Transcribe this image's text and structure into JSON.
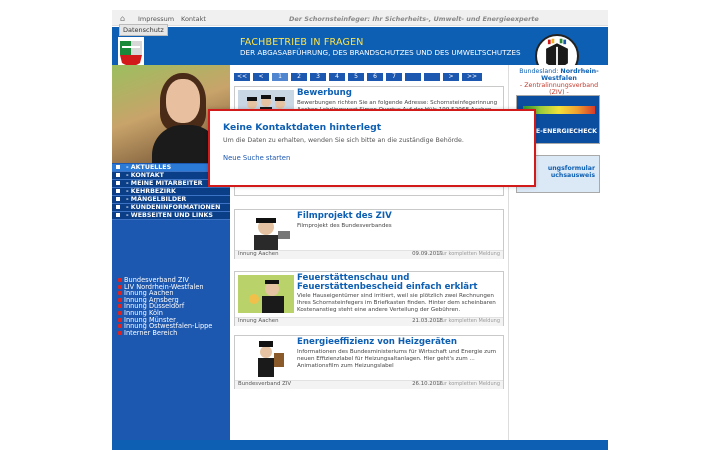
{
  "topbar": {
    "impressum": "Impressum",
    "kontakt": "Kontakt",
    "slogan": "Der Schornsteinfeger: Ihr Sicherheits-, Umwelt- und Energieexperte",
    "datenschutz": "Datenschutz"
  },
  "header": {
    "line1": "FACHBETRIEB IN FRAGEN",
    "line2": "DER ABGASABFÜHRUNG, DES BRANDSCHUTZES UND DES UMWELTSCHUTZES"
  },
  "nav": [
    {
      "label": "- AKTUELLES",
      "active": true
    },
    {
      "label": "- KONTAKT"
    },
    {
      "label": "- MEINE MITARBEITER"
    },
    {
      "label": "- KEHRBEZIRK"
    },
    {
      "label": "- MÄNGELBILDER"
    },
    {
      "label": "- KUNDENINFORMATIONEN"
    },
    {
      "label": "- WEBSEITEN UND LINKS"
    }
  ],
  "links": [
    "Bundesverband ZIV",
    "LIV Nordrhein-Westfalen",
    "Innung Aachen",
    "Innung Arnsberg",
    "Innung Düsseldorf",
    "Innung Köln",
    "Innung Münster",
    "Innung Ostwestfalen-Lippe",
    "Interner Bereich"
  ],
  "pager": [
    "<<",
    "<",
    "1",
    "2",
    "3",
    "4",
    "5",
    "6",
    "7",
    "",
    "",
    ">",
    ">>"
  ],
  "cards": [
    {
      "title": "Bewerbung",
      "text": "Bewerbungen richten Sie an folgende Adresse: Schornsteinfegerinnung Aachen Lehrlingswart  Simon Overtus Auf der Hüls 199 52068 Aachen",
      "source": "",
      "date": "",
      "more": ""
    },
    {
      "title": "Filmprojekt des ZIV",
      "text": "Filmprojekt des Bundesverbandes",
      "source": "Innung Aachen",
      "date": "09.09.2019",
      "more": "Zur kompletten Meldung"
    },
    {
      "title": "Feuerstättenschau und Feuerstättenbescheid einfach erklärt",
      "text": "Viele Hauseigentümer sind irritiert, weil sie plötzlich zwei Rechnungen Ihres Schornsteinfegers im Briefkasten finden. Hinter dem scheinbaren Kostenanstieg steht eine andere Verteilung der Gebühren.",
      "source": "Innung Aachen",
      "date": "21.03.2018",
      "more": "Zur kompletten Meldung"
    },
    {
      "title": "Energieeffizienz von Heizgeräten",
      "text": "Informationen des Bundesministeriums für Wirtschaft und Energie zum neuen Effizienzlabel für Heizungsaltanlagen.  Hier geht's zum ... Animationsfilm zum Heizungslabel",
      "source": "Bundesverband ZIV",
      "date": "26.10.2016",
      "more": "Zur kompletten Meldung"
    }
  ],
  "right": {
    "state_prefix": "Bundesland: ",
    "state_name": "Nordrhein-Westfalen",
    "ziv": "- Zentralinnungsverband (ZIV) -",
    "box1_label": "NE-ENERGIECHECK",
    "box2_line1": "ungsformular",
    "box2_line2": "uchsausweis"
  },
  "modal": {
    "title": "Keine Kontaktdaten hinterlegt",
    "text": "Um die Daten zu erhalten, wenden Sie sich bitte an die zuständige Behörde.",
    "link": "Neue Suche starten"
  },
  "colors": {
    "brand_blue": "#0d5fb3",
    "header_yellow": "#ffe44a",
    "modal_border": "#d21a1a"
  }
}
